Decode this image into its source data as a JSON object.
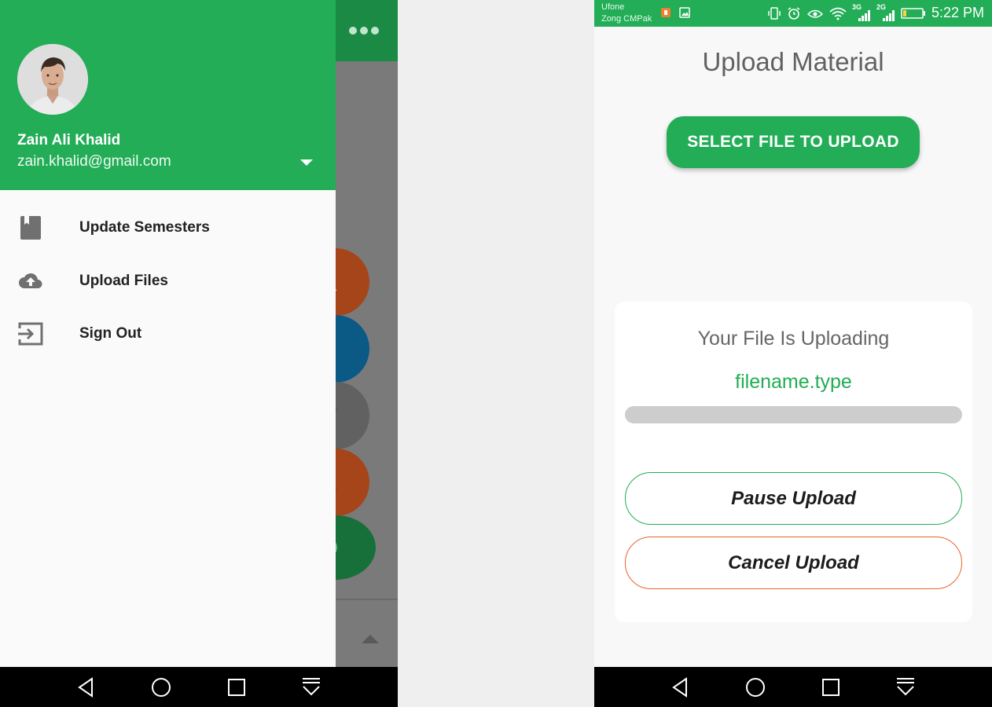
{
  "left_screen": {
    "drawer": {
      "user_name": "Zain Ali Khalid",
      "user_email": "zain.khalid@gmail.com",
      "menu": [
        {
          "label": "Update Semesters",
          "icon": "book-icon"
        },
        {
          "label": "Upload Files",
          "icon": "cloud-upload-icon"
        },
        {
          "label": "Sign Out",
          "icon": "exit-icon"
        }
      ]
    },
    "background_fabs": [
      "zoom-in-icon",
      "eraser-icon",
      "pencil-icon",
      "globe-search-icon",
      "close-circle-icon"
    ]
  },
  "right_screen": {
    "status_bar": {
      "carriers": [
        "Ufone",
        "Zong CMPak"
      ],
      "network_1": "3G",
      "network_2": "2G",
      "time": "5:22 PM"
    },
    "title": "Upload Material",
    "select_button": "SELECT FILE TO UPLOAD",
    "upload_card": {
      "status_text": "Your File Is Uploading",
      "file_name": "filename.type",
      "progress": 0,
      "pause_button": "Pause Upload",
      "cancel_button": "Cancel Upload"
    }
  },
  "colors": {
    "primary_green": "#22ad56",
    "cancel_orange": "#e8642c",
    "progress_track": "#cdcdcd"
  }
}
